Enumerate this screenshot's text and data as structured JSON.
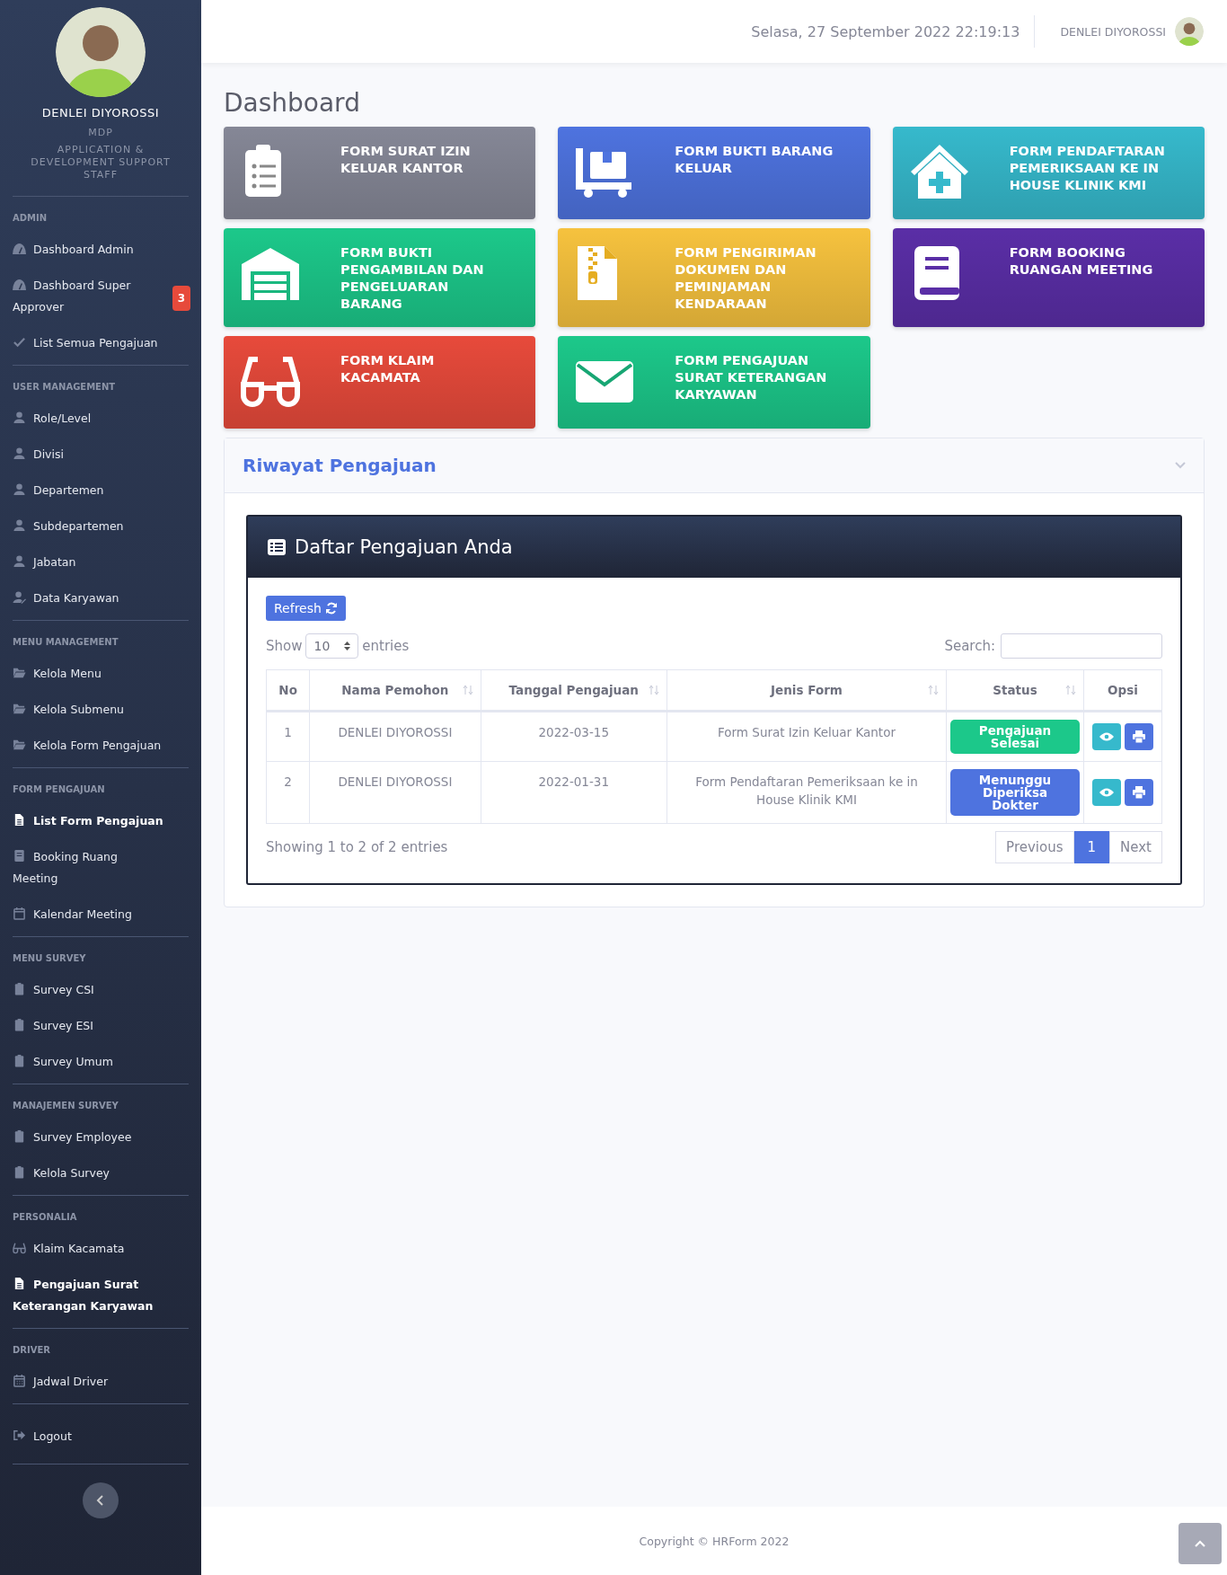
{
  "sidebar": {
    "profile": {
      "name": "DENLEI DIYOROSSI",
      "company": "MDP",
      "position": "APPLICATION & DEVELOPMENT SUPPORT STAFF"
    },
    "sections": [
      {
        "heading": "ADMIN",
        "items": [
          {
            "label": "Dashboard Admin",
            "selected": false
          },
          {
            "label": "Dashboard Super Approver",
            "selected": false,
            "badge": "3"
          },
          {
            "label": "List Semua Pengajuan",
            "selected": false
          }
        ]
      },
      {
        "heading": "USER MANAGEMENT",
        "items": [
          {
            "label": "Role/Level",
            "selected": false
          },
          {
            "label": "Divisi",
            "selected": false
          },
          {
            "label": "Departemen",
            "selected": false
          },
          {
            "label": "Subdepartemen",
            "selected": false
          },
          {
            "label": "Jabatan",
            "selected": false
          },
          {
            "label": "Data Karyawan",
            "selected": false
          }
        ]
      },
      {
        "heading": "MENU MANAGEMENT",
        "items": [
          {
            "label": "Kelola Menu",
            "selected": false
          },
          {
            "label": "Kelola Submenu",
            "selected": false
          },
          {
            "label": "Kelola Form Pengajuan",
            "selected": false
          }
        ]
      },
      {
        "heading": "FORM PENGAJUAN",
        "items": [
          {
            "label": "List Form Pengajuan",
            "selected": true
          },
          {
            "label": "Booking Ruang Meeting",
            "selected": false
          },
          {
            "label": "Kalendar Meeting",
            "selected": false
          }
        ]
      },
      {
        "heading": "MENU SURVEY",
        "items": [
          {
            "label": "Survey CSI",
            "selected": false
          },
          {
            "label": "Survey ESI",
            "selected": false
          },
          {
            "label": "Survey Umum",
            "selected": false
          }
        ]
      },
      {
        "heading": "MANAJEMEN SURVEY",
        "items": [
          {
            "label": "Survey Employee",
            "selected": false
          },
          {
            "label": "Kelola Survey",
            "selected": false
          }
        ]
      },
      {
        "heading": "PERSONALIA",
        "items": [
          {
            "label": "Klaim Kacamata",
            "selected": false
          },
          {
            "label": "Pengajuan Surat Keterangan Karyawan",
            "selected": true
          }
        ]
      },
      {
        "heading": "DRIVER",
        "items": [
          {
            "label": "Jadwal Driver",
            "selected": false
          }
        ]
      },
      {
        "items": [
          {
            "label": "Logout",
            "selected": false
          }
        ]
      }
    ]
  },
  "topbar": {
    "datetime": "Selasa, 27 September 2022 22:19:13",
    "user": "DENLEI DIYOROSSI"
  },
  "page_title": "Dashboard",
  "cards": [
    {
      "title": "FORM SURAT IZIN KELUAR KANTOR",
      "color": "#858796"
    },
    {
      "title": "FORM BUKTI BARANG KELUAR",
      "color": "#4e73df"
    },
    {
      "title": "FORM PENDAFTARAN PEMERIKSAAN KE IN HOUSE KLINIK KMI",
      "color": "#36b9cc"
    },
    {
      "title": "FORM BUKTI PENGAMBILAN DAN PENGELUARAN BARANG",
      "color": "#1cc88a"
    },
    {
      "title": "FORM PENGIRIMAN DOKUMEN DAN PEMINJAMAN KENDARAAN",
      "color": "#f6c23e"
    },
    {
      "title": "FORM BOOKING RUANGAN MEETING",
      "color": "#5a2ea6"
    },
    {
      "title": "FORM KLAIM KACAMATA",
      "color": "#e74a3b"
    },
    {
      "title": "FORM PENGAJUAN SURAT KETERANGAN KARYAWAN",
      "color": "#1cc88a"
    }
  ],
  "history": {
    "title": "Riwayat Pengajuan",
    "table_card": {
      "title": "Daftar Pengajuan Anda",
      "refresh": "Refresh",
      "show_label": "Show",
      "page_size": "10",
      "entries_label": "entries",
      "search_label": "Search:",
      "columns": [
        {
          "label": "No",
          "sortable": false
        },
        {
          "label": "Nama Pemohon",
          "sortable": true
        },
        {
          "label": "Tanggal Pengajuan",
          "sortable": true
        },
        {
          "label": "Jenis Form",
          "sortable": true
        },
        {
          "label": "Status",
          "sortable": true
        },
        {
          "label": "Opsi",
          "sortable": false
        }
      ],
      "rows": [
        {
          "no": "1",
          "name": "DENLEI DIYOROSSI",
          "date": "2022-03-15",
          "form": "Form Surat Izin Keluar Kantor",
          "status": {
            "text": "Pengajuan Selesai",
            "color": "#1cc88a"
          }
        },
        {
          "no": "2",
          "name": "DENLEI DIYOROSSI",
          "date": "2022-01-31",
          "form": "Form Pendaftaran Pemeriksaan ke in House Klinik KMI",
          "status": {
            "text": "Menunggu Diperiksa Dokter",
            "color": "#4e73df"
          }
        }
      ],
      "info": "Showing 1 to 2 of 2 entries",
      "pagination": {
        "previous": "Previous",
        "pages": [
          {
            "label": "1",
            "selected": true
          }
        ],
        "next": "Next"
      }
    }
  },
  "footer": "Copyright © HRForm 2022"
}
